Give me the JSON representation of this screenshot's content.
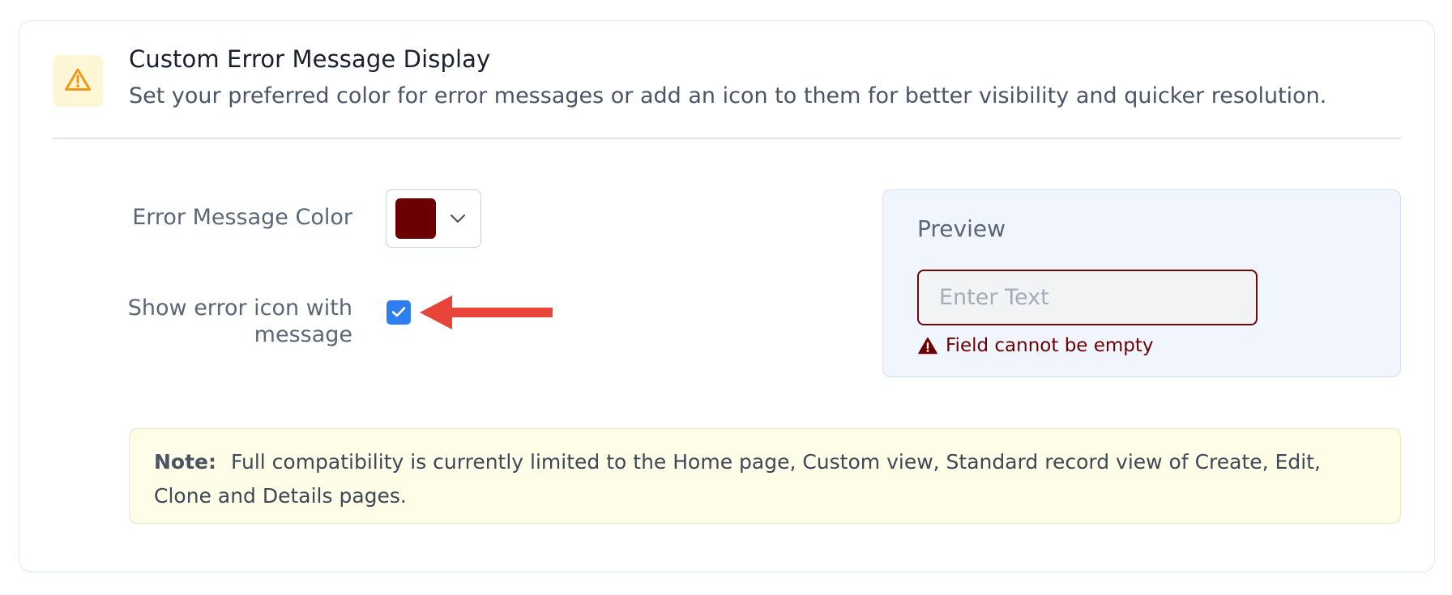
{
  "header": {
    "icon": "warning-triangle-icon",
    "title": "Custom Error Message Display",
    "description": "Set your preferred color for error messages or add an icon to them for better visibility and quicker resolution."
  },
  "settings": {
    "color_label": "Error Message Color",
    "color_value": "#6b0000",
    "icon_label": "Show error icon with message",
    "icon_checked": true
  },
  "preview": {
    "title": "Preview",
    "input_placeholder": "Enter Text",
    "error_text": "Field cannot be empty",
    "error_color": "#6b0000"
  },
  "note": {
    "label": "Note:",
    "text": "Full compatibility is currently limited to the Home page, Custom view, Standard record view of Create, Edit, Clone and Details pages."
  },
  "colors": {
    "checkbox": "#2d7ff0",
    "annotation_arrow": "#e8443a",
    "header_icon": "#f09a1b"
  }
}
